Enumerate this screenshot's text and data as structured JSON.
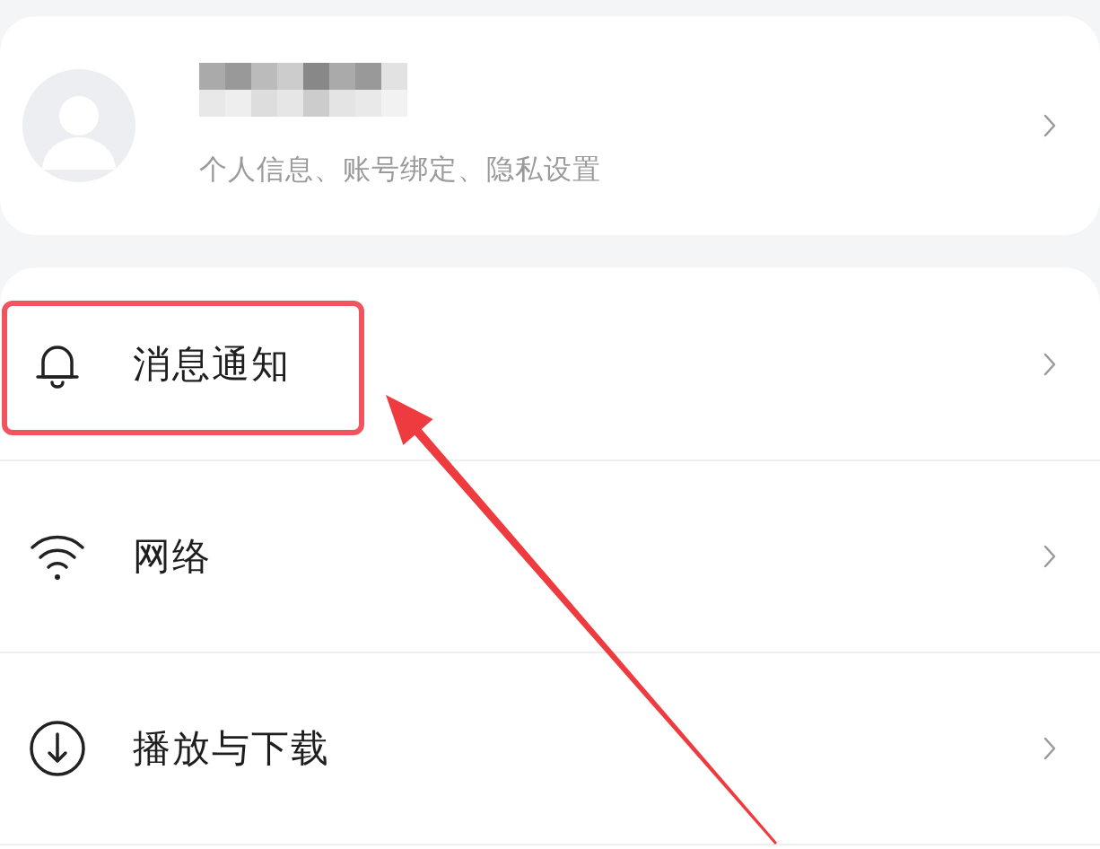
{
  "profile": {
    "subtitle": "个人信息、账号绑定、隐私设置"
  },
  "menu": [
    {
      "kind": "bell",
      "label": "消息通知",
      "highlighted": true
    },
    {
      "kind": "wifi",
      "label": "网络",
      "highlighted": false
    },
    {
      "kind": "download",
      "label": "播放与下载",
      "highlighted": false
    }
  ],
  "annotation": {
    "kind": "arrow"
  }
}
